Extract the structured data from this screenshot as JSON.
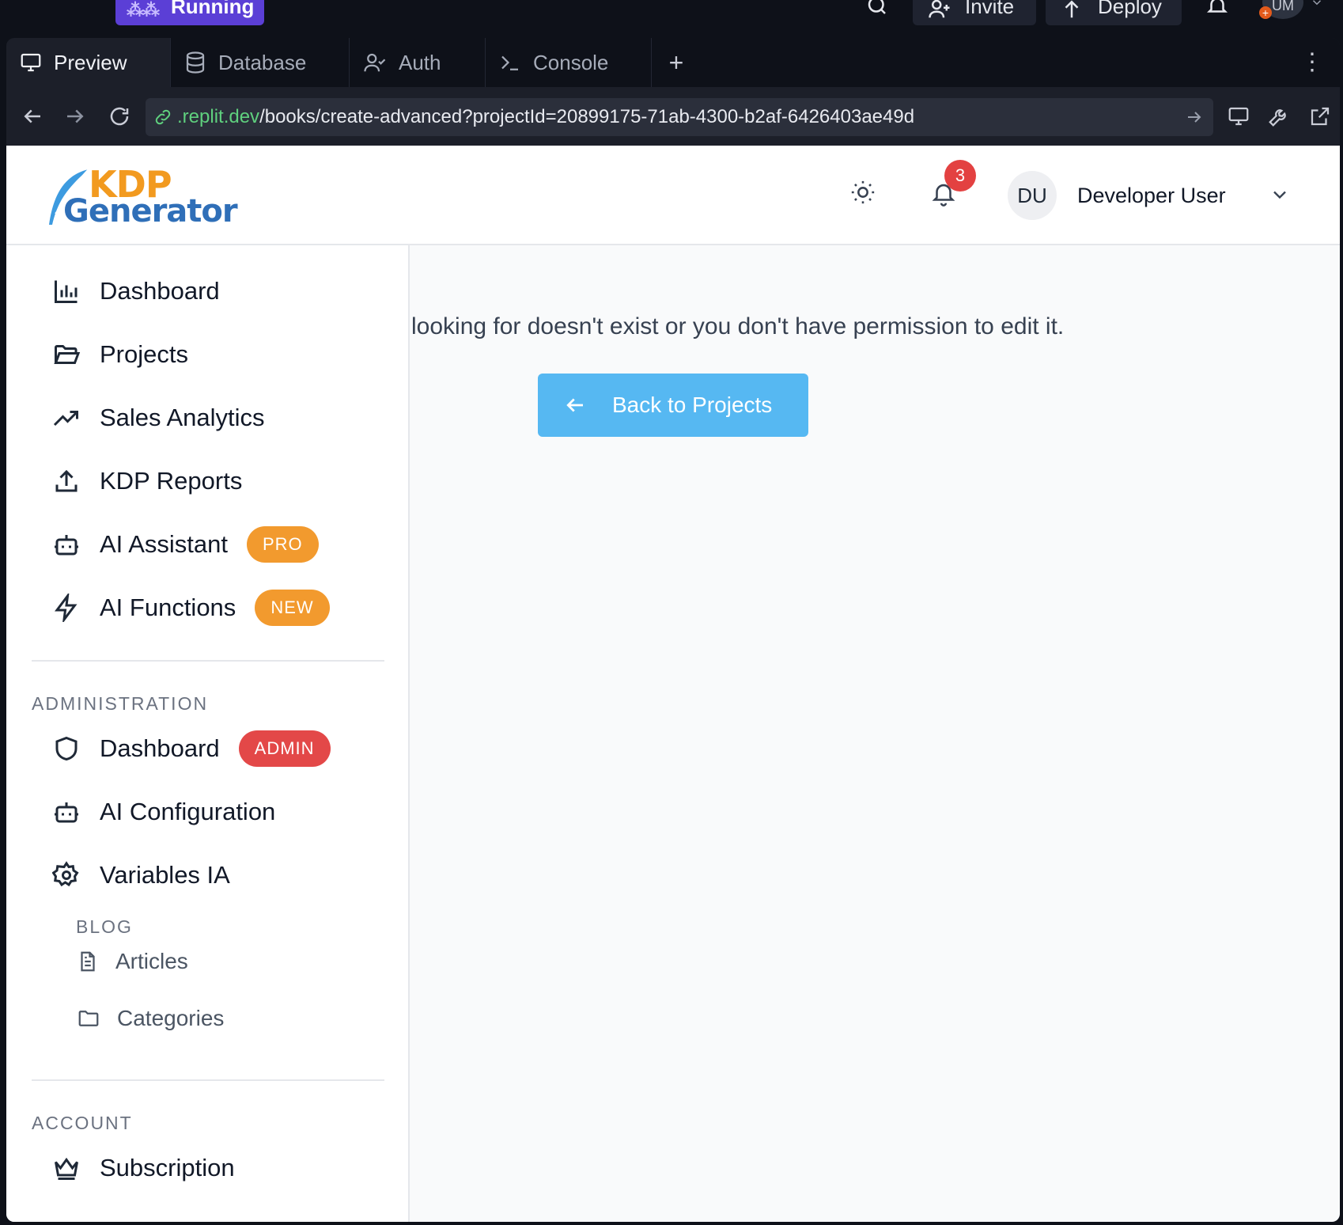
{
  "ide": {
    "run_label": "Running",
    "invite_label": "Invite",
    "deploy_label": "Deploy",
    "user_initials": "UM"
  },
  "tabs": [
    {
      "label": "Preview",
      "icon": "monitor-icon"
    },
    {
      "label": "Database",
      "icon": "database-icon"
    },
    {
      "label": "Auth",
      "icon": "user-check-icon"
    },
    {
      "label": "Console",
      "icon": "terminal-icon"
    }
  ],
  "url": {
    "domain": ".replit.dev",
    "path": "/books/create-advanced?projectId=20899175-71ab-4300-b2af-6426403ae49d"
  },
  "app": {
    "logo_top": "KDP",
    "logo_bottom": "Generator",
    "notifications_count": "3",
    "user_initials": "DU",
    "user_name": "Developer User"
  },
  "sidebar": {
    "main_items": [
      {
        "label": "Dashboard",
        "icon": "bar-chart-icon"
      },
      {
        "label": "Projects",
        "icon": "folder-open-icon"
      },
      {
        "label": "Sales Analytics",
        "icon": "trending-up-icon"
      },
      {
        "label": "KDP Reports",
        "icon": "upload-icon"
      },
      {
        "label": "AI Assistant",
        "icon": "bot-icon",
        "badge": "PRO"
      },
      {
        "label": "AI Functions",
        "icon": "zap-icon",
        "badge": "NEW"
      }
    ],
    "admin_title": "ADMINISTRATION",
    "admin_items": [
      {
        "label": "Dashboard",
        "icon": "shield-icon",
        "badge": "ADMIN"
      },
      {
        "label": "AI Configuration",
        "icon": "bot-icon"
      },
      {
        "label": "Variables IA",
        "icon": "gear-icon"
      }
    ],
    "blog_title": "BLOG",
    "blog_items": [
      {
        "label": "Articles",
        "icon": "file-text-icon"
      },
      {
        "label": "Categories",
        "icon": "folder-icon"
      }
    ],
    "account_title": "ACCOUNT",
    "account_items": [
      {
        "label": "Subscription",
        "icon": "crown-icon"
      }
    ]
  },
  "main": {
    "message": "looking for doesn't exist or you don't have permission to edit it.",
    "back_button": "Back to Projects"
  },
  "colors": {
    "accent_button": "#56b8f2",
    "badge_orange": "#f29a2e",
    "badge_red": "#e34848",
    "run_purple": "#5b3fd6"
  }
}
